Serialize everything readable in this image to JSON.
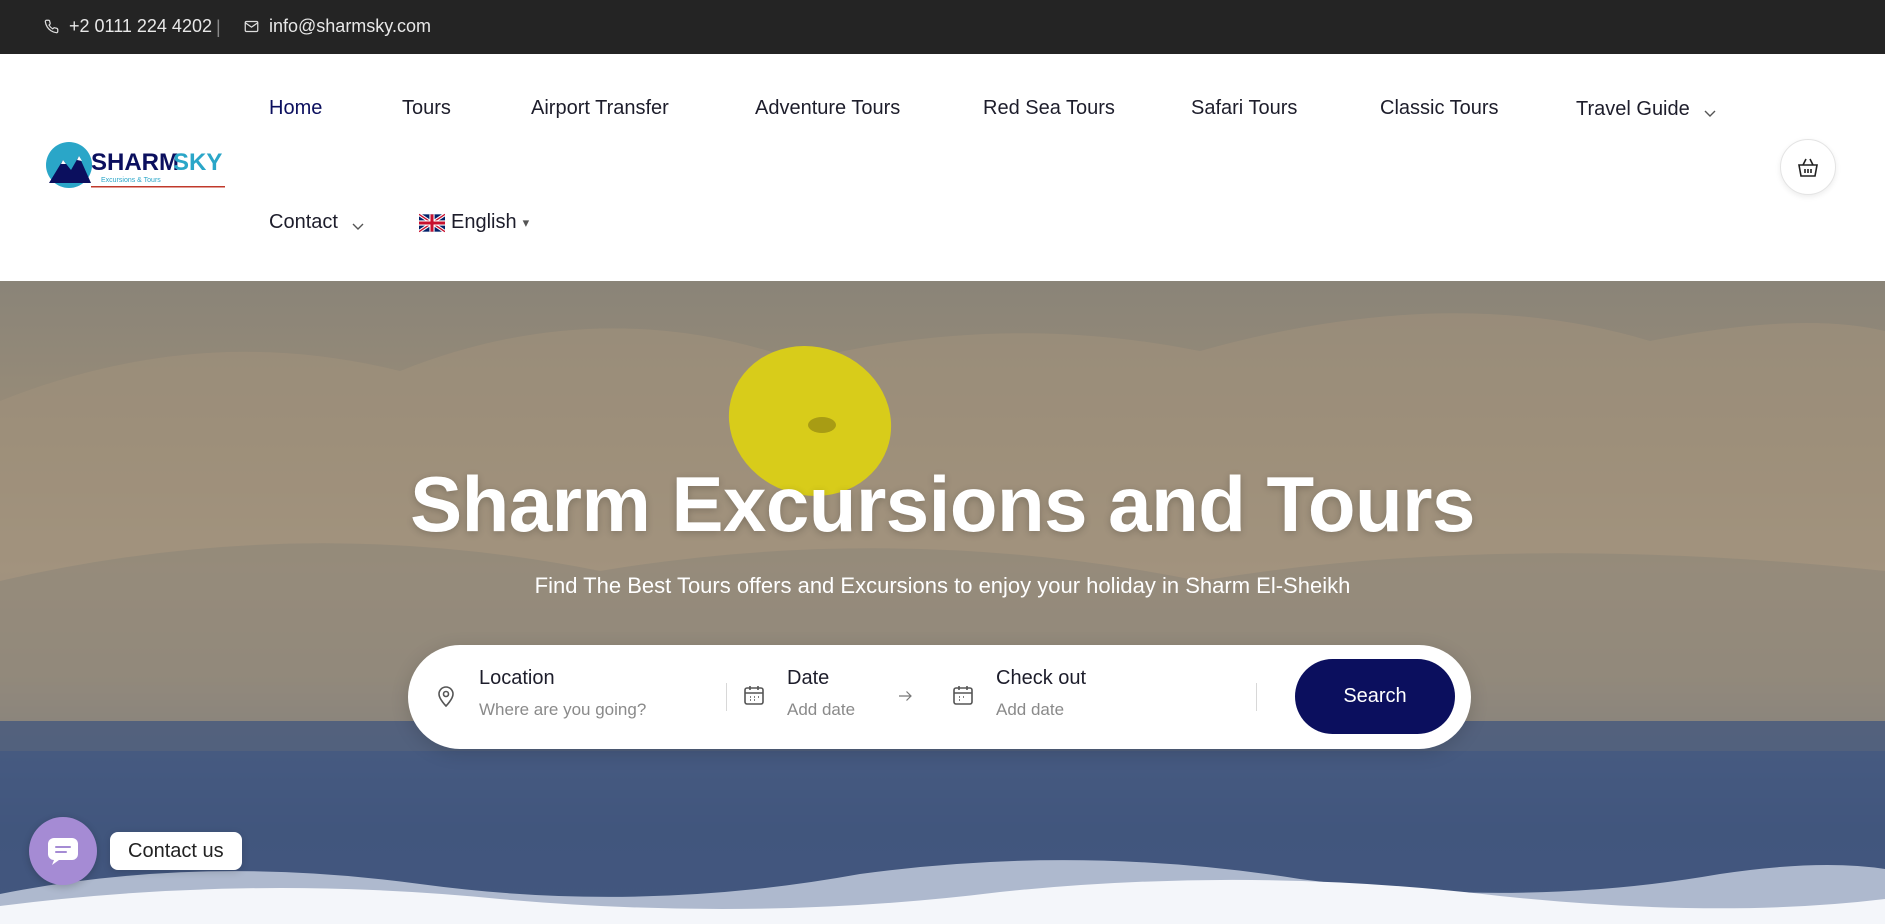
{
  "topbar": {
    "phone": "+2 0111 224 4202",
    "separator": "|",
    "email": "info@sharmsky.com"
  },
  "logo": {
    "brand": "SHARMSKY",
    "tagline": "Excursions & Tours"
  },
  "nav": {
    "home": "Home",
    "tours": "Tours",
    "airport_transfer": "Airport Transfer",
    "adventure_tours": "Adventure Tours",
    "red_sea_tours": "Red Sea Tours",
    "safari_tours": "Safari Tours",
    "classic_tours": "Classic Tours",
    "travel_guide": "Travel Guide",
    "contact": "Contact",
    "language": "English",
    "language_caret": "▾"
  },
  "hero": {
    "title": "Sharm Excursions and Tours",
    "subtitle": "Find The Best Tours offers and Excursions to enjoy your holiday in Sharm El-Sheikh"
  },
  "search": {
    "location_label": "Location",
    "location_placeholder": "Where are you going?",
    "date_label": "Date",
    "date_placeholder": "Add date",
    "checkout_label": "Check out",
    "checkout_placeholder": "Add date",
    "button": "Search"
  },
  "contact_widget": {
    "label": "Contact us"
  },
  "colors": {
    "topbar_bg": "#242424",
    "brand_navy": "#0b0f5e",
    "contact_purple": "#a58bd4"
  }
}
